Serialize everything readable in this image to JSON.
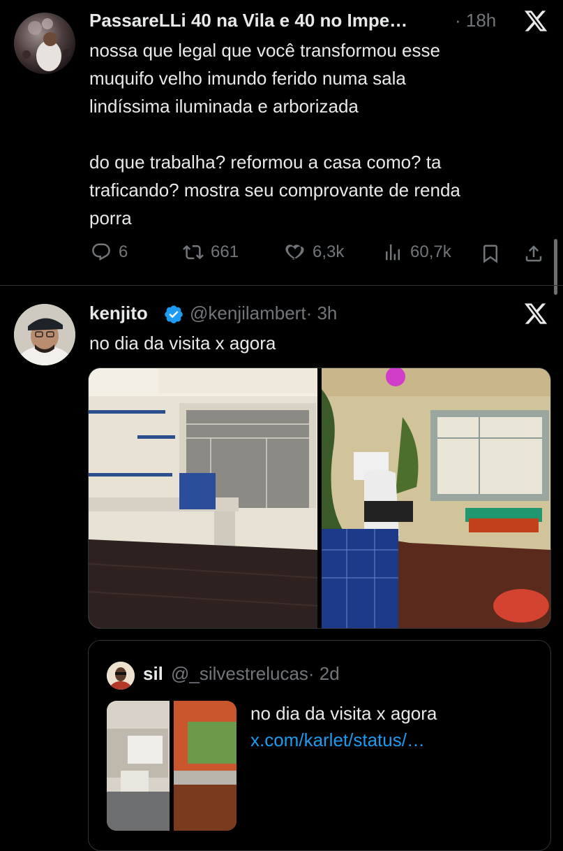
{
  "tweet1": {
    "display_name": "PassareLLi 40 na Vila e 40 no Impe…",
    "time": "· 18h",
    "lines": [
      "nossa que legal que você transformou esse",
      "muquifo velho imundo ferido numa sala",
      "lindíssima iluminada e arborizada",
      "",
      "do que trabalha? reformou a casa como? ta",
      "traficando? mostra seu comprovante de renda",
      "porra"
    ],
    "actions": {
      "replies": "6",
      "reposts": "661",
      "likes": "6,3k",
      "views": "60,7k"
    }
  },
  "tweet2": {
    "display_name": "kenjito",
    "handle": "@kenjilambert",
    "time": "· 3h",
    "text": "no dia da visita x agora",
    "quote": {
      "display_name": "sil",
      "handle": "@_silvestrelucas",
      "time": "· 2d",
      "text": "no dia da visita x agora",
      "link": "x.com/karlet/status/…"
    }
  },
  "colors": {
    "background": "#000000",
    "text": "#e7e9ea",
    "muted": "#71767b",
    "link": "#1d9bf0",
    "verified": "#1d9bf0"
  },
  "icons": [
    "x-logo-icon",
    "reply-icon",
    "repost-icon",
    "like-icon",
    "views-icon",
    "bookmark-icon",
    "share-icon",
    "verified-badge-icon"
  ]
}
